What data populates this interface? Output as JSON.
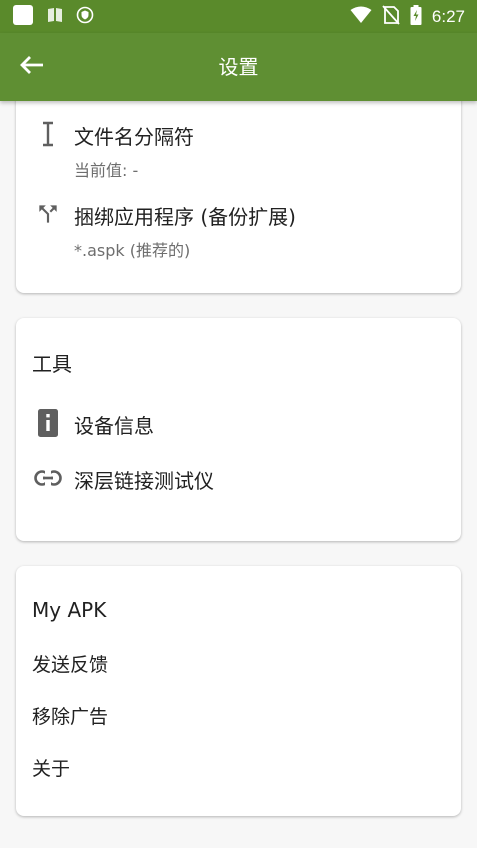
{
  "status_bar": {
    "time": "6:27",
    "icons": [
      "square-notification-icon",
      "book-icon",
      "shield-icon",
      "wifi-icon",
      "no-sim-icon",
      "battery-charging-icon"
    ]
  },
  "app_bar": {
    "title": "设置",
    "back_icon": "arrow-left-icon"
  },
  "card1": {
    "items": [
      {
        "icon": "text-cursor-icon",
        "title": "文件名分隔符",
        "subtitle": "当前值: -"
      },
      {
        "icon": "call-split-icon",
        "title": "捆绑应用程序 (备份扩展)",
        "subtitle": "*.aspk (推荐的)"
      }
    ]
  },
  "card2": {
    "title": "工具",
    "items": [
      {
        "icon": "device-info-icon",
        "label": "设备信息"
      },
      {
        "icon": "link-icon",
        "label": "深层链接测试仪"
      }
    ]
  },
  "card3": {
    "title": "My APK",
    "items": [
      {
        "label": "发送反馈"
      },
      {
        "label": "移除广告"
      },
      {
        "label": "关于"
      }
    ]
  },
  "colors": {
    "status_bar": "#5a8a2b",
    "app_bar": "#5f8f33",
    "background": "#f7f7f7",
    "card": "#ffffff",
    "icon": "#5f5f5f"
  }
}
